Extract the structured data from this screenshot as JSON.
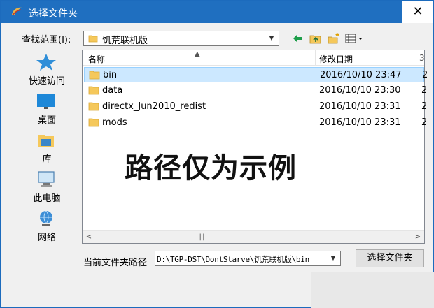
{
  "window": {
    "title": "选择文件夹",
    "close": "✕"
  },
  "lookin": {
    "label": "查找范围(I):",
    "value": "饥荒联机版"
  },
  "places": [
    {
      "label": "快速访问",
      "icon": "star-icon"
    },
    {
      "label": "桌面",
      "icon": "desktop-icon"
    },
    {
      "label": "库",
      "icon": "library-icon"
    },
    {
      "label": "此电脑",
      "icon": "computer-icon"
    },
    {
      "label": "网络",
      "icon": "network-icon"
    }
  ],
  "columns": {
    "name": "名称",
    "date": "修改日期",
    "more": "3"
  },
  "files": [
    {
      "name": "bin",
      "date": "2016/10/10 23:47",
      "trunc": "2"
    },
    {
      "name": "data",
      "date": "2016/10/10 23:30",
      "trunc": "2"
    },
    {
      "name": "directx_Jun2010_redist",
      "date": "2016/10/10 23:31",
      "trunc": "2"
    },
    {
      "name": "mods",
      "date": "2016/10/10 23:31",
      "trunc": "2"
    }
  ],
  "watermark": "路径仅为示例",
  "path": {
    "label": "当前文件夹路径",
    "value": "D:\\TGP-DST\\DontStarve\\饥荒联机版\\bin"
  },
  "select_button": "选择文件夹",
  "colors": {
    "titlebar": "#1f6fc0",
    "selection": "#cce8ff",
    "folder": "#f5c85b"
  }
}
